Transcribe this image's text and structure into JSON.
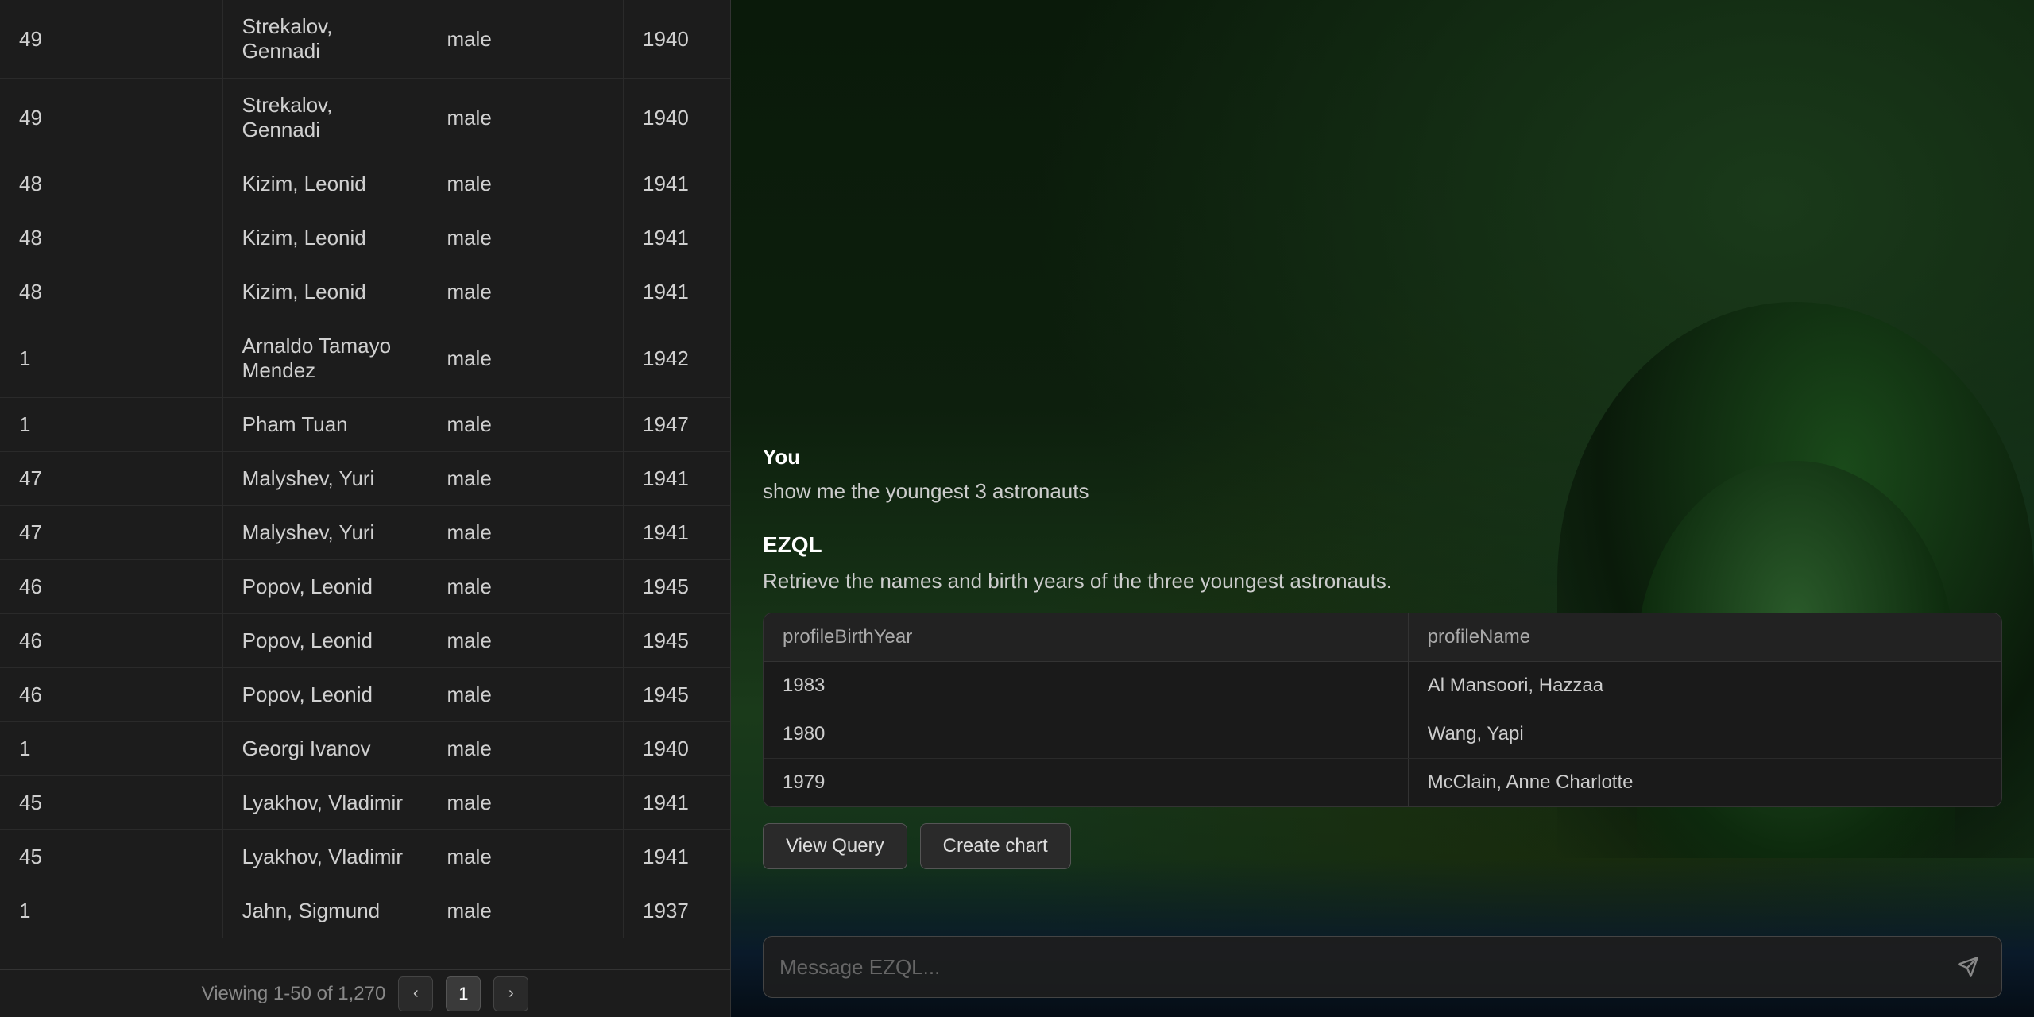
{
  "table": {
    "rows": [
      {
        "col1": "49",
        "col2": "Strekalov, Gennadi",
        "col3": "male",
        "col4": "1940"
      },
      {
        "col1": "49",
        "col2": "Strekalov, Gennadi",
        "col3": "male",
        "col4": "1940"
      },
      {
        "col1": "48",
        "col2": "Kizim, Leonid",
        "col3": "male",
        "col4": "1941"
      },
      {
        "col1": "48",
        "col2": "Kizim, Leonid",
        "col3": "male",
        "col4": "1941"
      },
      {
        "col1": "48",
        "col2": "Kizim, Leonid",
        "col3": "male",
        "col4": "1941"
      },
      {
        "col1": "1",
        "col2": "Arnaldo Tamayo Mendez",
        "col3": "male",
        "col4": "1942"
      },
      {
        "col1": "1",
        "col2": "Pham Tuan",
        "col3": "male",
        "col4": "1947"
      },
      {
        "col1": "47",
        "col2": "Malyshev, Yuri",
        "col3": "male",
        "col4": "1941"
      },
      {
        "col1": "47",
        "col2": "Malyshev, Yuri",
        "col3": "male",
        "col4": "1941"
      },
      {
        "col1": "46",
        "col2": "Popov, Leonid",
        "col3": "male",
        "col4": "1945"
      },
      {
        "col1": "46",
        "col2": "Popov, Leonid",
        "col3": "male",
        "col4": "1945"
      },
      {
        "col1": "46",
        "col2": "Popov, Leonid",
        "col3": "male",
        "col4": "1945"
      },
      {
        "col1": "1",
        "col2": "Georgi Ivanov",
        "col3": "male",
        "col4": "1940"
      },
      {
        "col1": "45",
        "col2": "Lyakhov, Vladimir",
        "col3": "male",
        "col4": "1941"
      },
      {
        "col1": "45",
        "col2": "Lyakhov, Vladimir",
        "col3": "male",
        "col4": "1941"
      },
      {
        "col1": "1",
        "col2": "Jahn, Sigmund",
        "col3": "male",
        "col4": "1937"
      }
    ]
  },
  "pagination": {
    "viewing_text": "Viewing 1-50 of 1,270",
    "current_page": "1"
  },
  "chat": {
    "user_label": "You",
    "user_message": "show me the youngest 3 astronauts",
    "ezql_label": "EZQL",
    "ezql_description": "Retrieve the names and birth years of the three youngest astronauts.",
    "result_table": {
      "col1_header": "profileBirthYear",
      "col2_header": "profileName",
      "rows": [
        {
          "year": "1983",
          "name": "Al Mansoori, Hazzaa"
        },
        {
          "year": "1980",
          "name": "Wang, Yapi"
        },
        {
          "year": "1979",
          "name": "McClain, Anne Charlotte"
        }
      ]
    },
    "view_query_label": "View Query",
    "create_chart_label": "Create chart",
    "input_placeholder": "Message EZQL..."
  }
}
